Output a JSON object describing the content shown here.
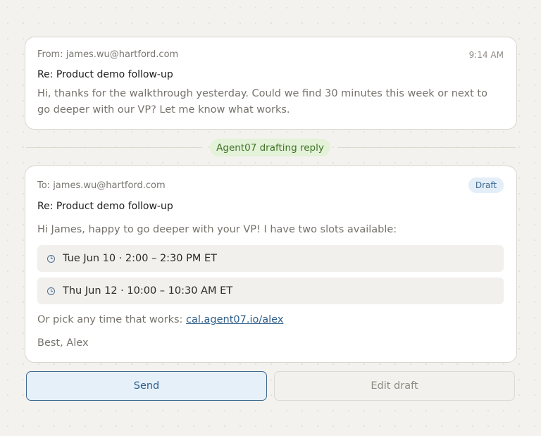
{
  "incoming": {
    "from": "From: james.wu@hartford.com",
    "time": "9:14 AM",
    "subject": "Re: Product demo follow-up",
    "body": "Hi, thanks for the walkthrough yesterday. Could we find 30 minutes this week or next to go deeper with our VP? Let me know what works."
  },
  "status": {
    "label": "Agent07 drafting reply",
    "bg_color": "#e3f2d8",
    "text_color": "#42722a"
  },
  "draft": {
    "to": "To: james.wu@hartford.com",
    "badge": "Draft",
    "subject": "Re: Product demo follow-up",
    "greeting": "Hi James, happy to go deeper with your VP! I have two slots available:",
    "slots": [
      {
        "icon": "clock-icon",
        "label": "Tue Jun 10 · 2:00 – 2:30 PM ET"
      },
      {
        "icon": "clock-icon",
        "label": "Thu Jun 12 · 10:00 – 10:30 AM ET"
      }
    ],
    "alt_prefix": "Or pick any time that works: ",
    "alt_link": "cal.agent07.io/alex",
    "signoff": "Best, Alex"
  },
  "actions": {
    "send_label": "Send",
    "edit_label": "Edit draft",
    "accent_color": "#2f5f8a"
  }
}
